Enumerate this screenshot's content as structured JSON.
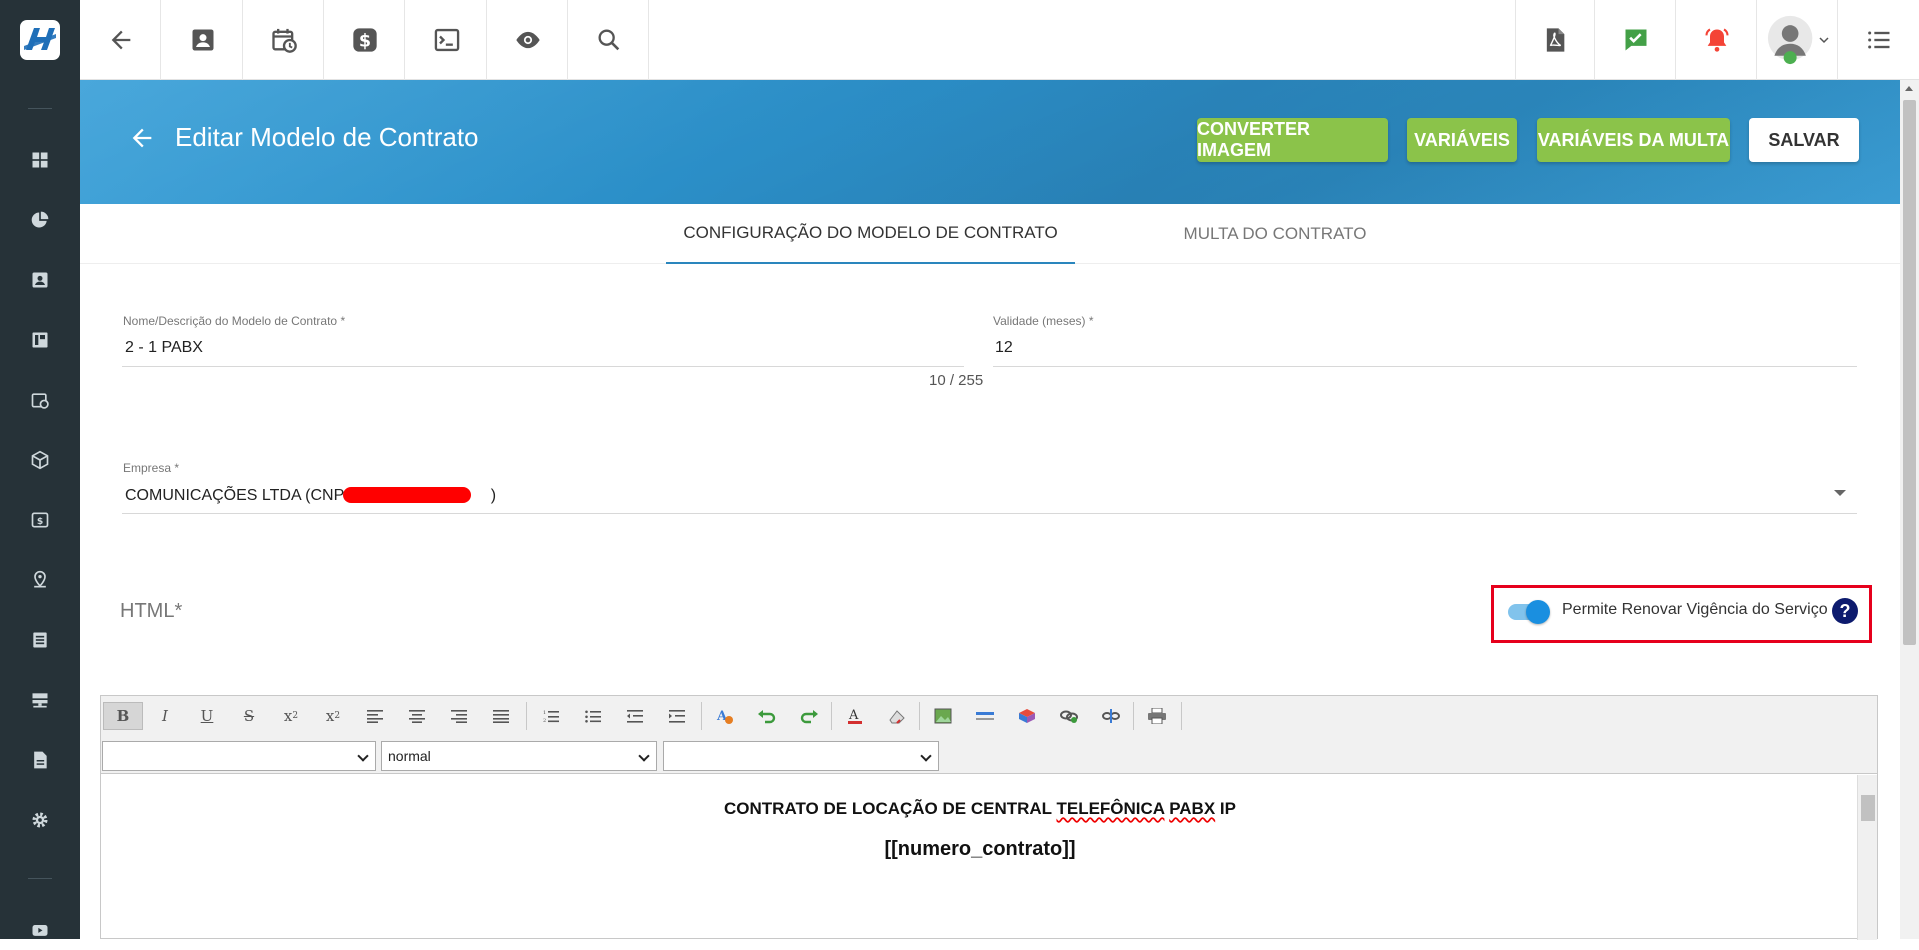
{
  "header": {
    "title": "Editar Modelo de Contrato",
    "buttons": {
      "convert_image": "CONVERTER IMAGEM",
      "variables": "VARIÁVEIS",
      "fine_variables": "VARIÁVEIS DA MULTA",
      "save": "SALVAR"
    }
  },
  "tabs": [
    {
      "label": "CONFIGURAÇÃO DO MODELO DE CONTRATO",
      "active": true
    },
    {
      "label": "MULTA DO CONTRATO",
      "active": false
    }
  ],
  "form": {
    "name_label": "Nome/Descrição do Modelo de Contrato *",
    "name_value": "2 - 1 PABX",
    "name_counter": "10 / 255",
    "validity_label": "Validade (meses) *",
    "validity_value": "12",
    "company_label": "Empresa *",
    "company_value_prefix": "COMUNICAÇÕES LTDA (CNPJ:",
    "company_value_suffix": ")",
    "html_label": "HTML*",
    "renew_toggle_label": "Permite Renovar Vigência do Serviço",
    "renew_toggle_on": true,
    "help_glyph": "?"
  },
  "editor": {
    "toolbar_buttons": [
      "bold",
      "italic",
      "underline",
      "strikethrough",
      "subscript",
      "superscript",
      "align-left",
      "align-center",
      "align-right",
      "align-justify",
      "ordered-list",
      "unordered-list",
      "outdent",
      "indent",
      "remove-format",
      "undo",
      "redo",
      "font-color",
      "highlight",
      "image",
      "horizontal-rule",
      "table",
      "link",
      "unlink",
      "print"
    ],
    "font_select": "",
    "size_select": "normal",
    "format_select": "",
    "doc_title_parts": [
      "CONTRATO DE LOCAÇÃO DE CENTRAL ",
      "TELEFÔNICA",
      " ",
      "PABX",
      " IP"
    ],
    "doc_variable": "[[numero_contrato]]"
  },
  "topbar": {
    "icons": [
      "back-arrow-icon",
      "contact-card-icon",
      "calendar-clock-icon",
      "dollar-icon",
      "terminal-icon",
      "eye-icon",
      "search-icon",
      "pdf-icon",
      "check-chat-icon",
      "alarm-bell-icon",
      "user-avatar-icon",
      "menu-list-icon"
    ]
  },
  "colors": {
    "accent_blue": "#2a86bd",
    "button_green": "#8bc34a",
    "sidebar": "#263238",
    "alert_red": "#f44336",
    "check_green": "#43a047",
    "highlight_box": "#e6001c"
  }
}
